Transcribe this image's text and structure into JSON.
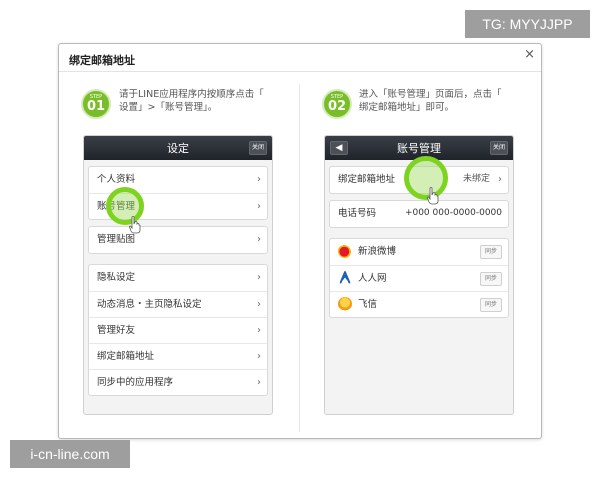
{
  "watermarks": {
    "top_right": "TG: MYYJJPP",
    "bottom_left": "i-cn-line.com"
  },
  "dialog": {
    "title": "绑定邮箱地址",
    "close": "×"
  },
  "steps": [
    {
      "word": "STEP",
      "number": "01",
      "line1": "请于LINE应用程序内按顺序点击「",
      "line2": "设置」>「账号管理」。"
    },
    {
      "word": "STEP",
      "number": "02",
      "line1": "进入「账号管理」页面后，点击「",
      "line2": "绑定邮箱地址」即可。"
    }
  ],
  "left_phone": {
    "title": "设定",
    "close": "关闭",
    "group1": [
      {
        "label": "个人资料"
      },
      {
        "label": "账号管理"
      }
    ],
    "group2": [
      {
        "label": "管理贴图"
      }
    ],
    "group3": [
      {
        "label": "隐私设定"
      },
      {
        "label": "动态消息・主页隐私设定"
      },
      {
        "label": "管理好友"
      },
      {
        "label": "绑定邮箱地址"
      },
      {
        "label": "同步中的应用程序"
      }
    ]
  },
  "right_phone": {
    "title": "账号管理",
    "back": "◀",
    "close": "关闭",
    "email_row": {
      "label": "绑定邮箱地址",
      "value": "未绑定"
    },
    "phone_row": {
      "label": "电话号码",
      "value": "+000 000-0000-0000"
    },
    "sns": [
      {
        "label": "新浪微博",
        "button": "同步",
        "icon": "weibo-icon"
      },
      {
        "label": "人人网",
        "button": "同步",
        "icon": "renren-icon"
      },
      {
        "label": "飞信",
        "button": "同步",
        "icon": "fetion-icon"
      }
    ]
  },
  "colors": {
    "step_green": "#79bd28",
    "header_dark": "#2b3038",
    "touch_green": "#7ed321"
  }
}
